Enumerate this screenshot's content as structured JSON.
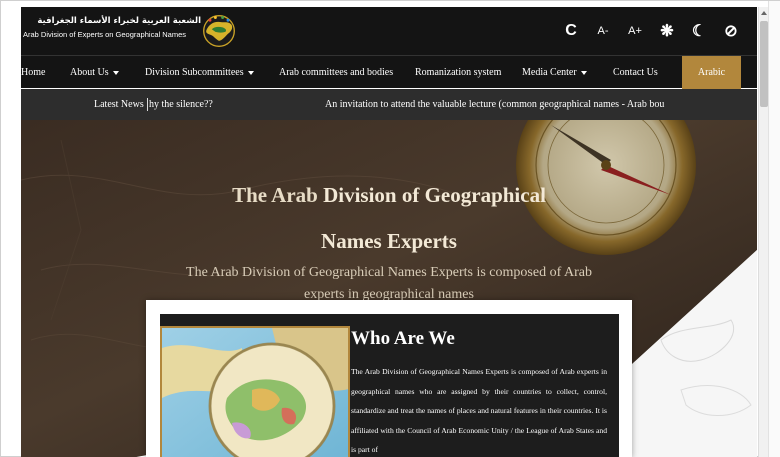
{
  "header": {
    "brand_ar": "الشعبة العربية لخبراء الأسماء الجغرافية",
    "brand_en": "Arab Division of Experts on Geographical Names",
    "logo_icon": "arab-map-globe-logo-icon",
    "tools": {
      "refresh_label": "C",
      "font_decrease_label": "A-",
      "font_increase_label": "A+",
      "contrast_label": "❋",
      "dark_mode_label": "☾",
      "hide_label": "⊘"
    }
  },
  "nav": {
    "items": [
      {
        "label": "Home",
        "has_caret": false
      },
      {
        "label": "About Us",
        "has_caret": true
      },
      {
        "label": "Division Subcommittees",
        "has_caret": true
      },
      {
        "label": "Arab committees and bodies",
        "has_caret": false
      },
      {
        "label": "Romanization system",
        "has_caret": false
      },
      {
        "label": "Media Center",
        "has_caret": true
      },
      {
        "label": "Contact Us",
        "has_caret": false
      }
    ],
    "language_button": "Arabic"
  },
  "ticker": {
    "label": "Latest News",
    "item1": "hy the silence??",
    "item2": "An invitation to attend the valuable lecture (common geographical names - Arab bou"
  },
  "hero": {
    "title_line1_plain": "The Arab ",
    "title_line1_bold": "Division of Geographical",
    "title_line2": "Names Experts",
    "subtitle": "The Arab Division of Geographical Names Experts is composed of Arab experts in geographical names"
  },
  "about": {
    "title": "Who Are We",
    "text": "The Arab Division of Geographical Names Experts is composed of Arab experts in geographical names who are assigned by their countries to collect, control, standardize and treat the names of places and natural features in their countries. It is affiliated with the Council of Arab Economic Unity / the League of Arab States and is part of"
  },
  "colors": {
    "header_bg": "#141414",
    "ticker_bg": "#2d2d2d",
    "accent_gold": "#b2873c",
    "card_bg": "#1d1d1d"
  }
}
